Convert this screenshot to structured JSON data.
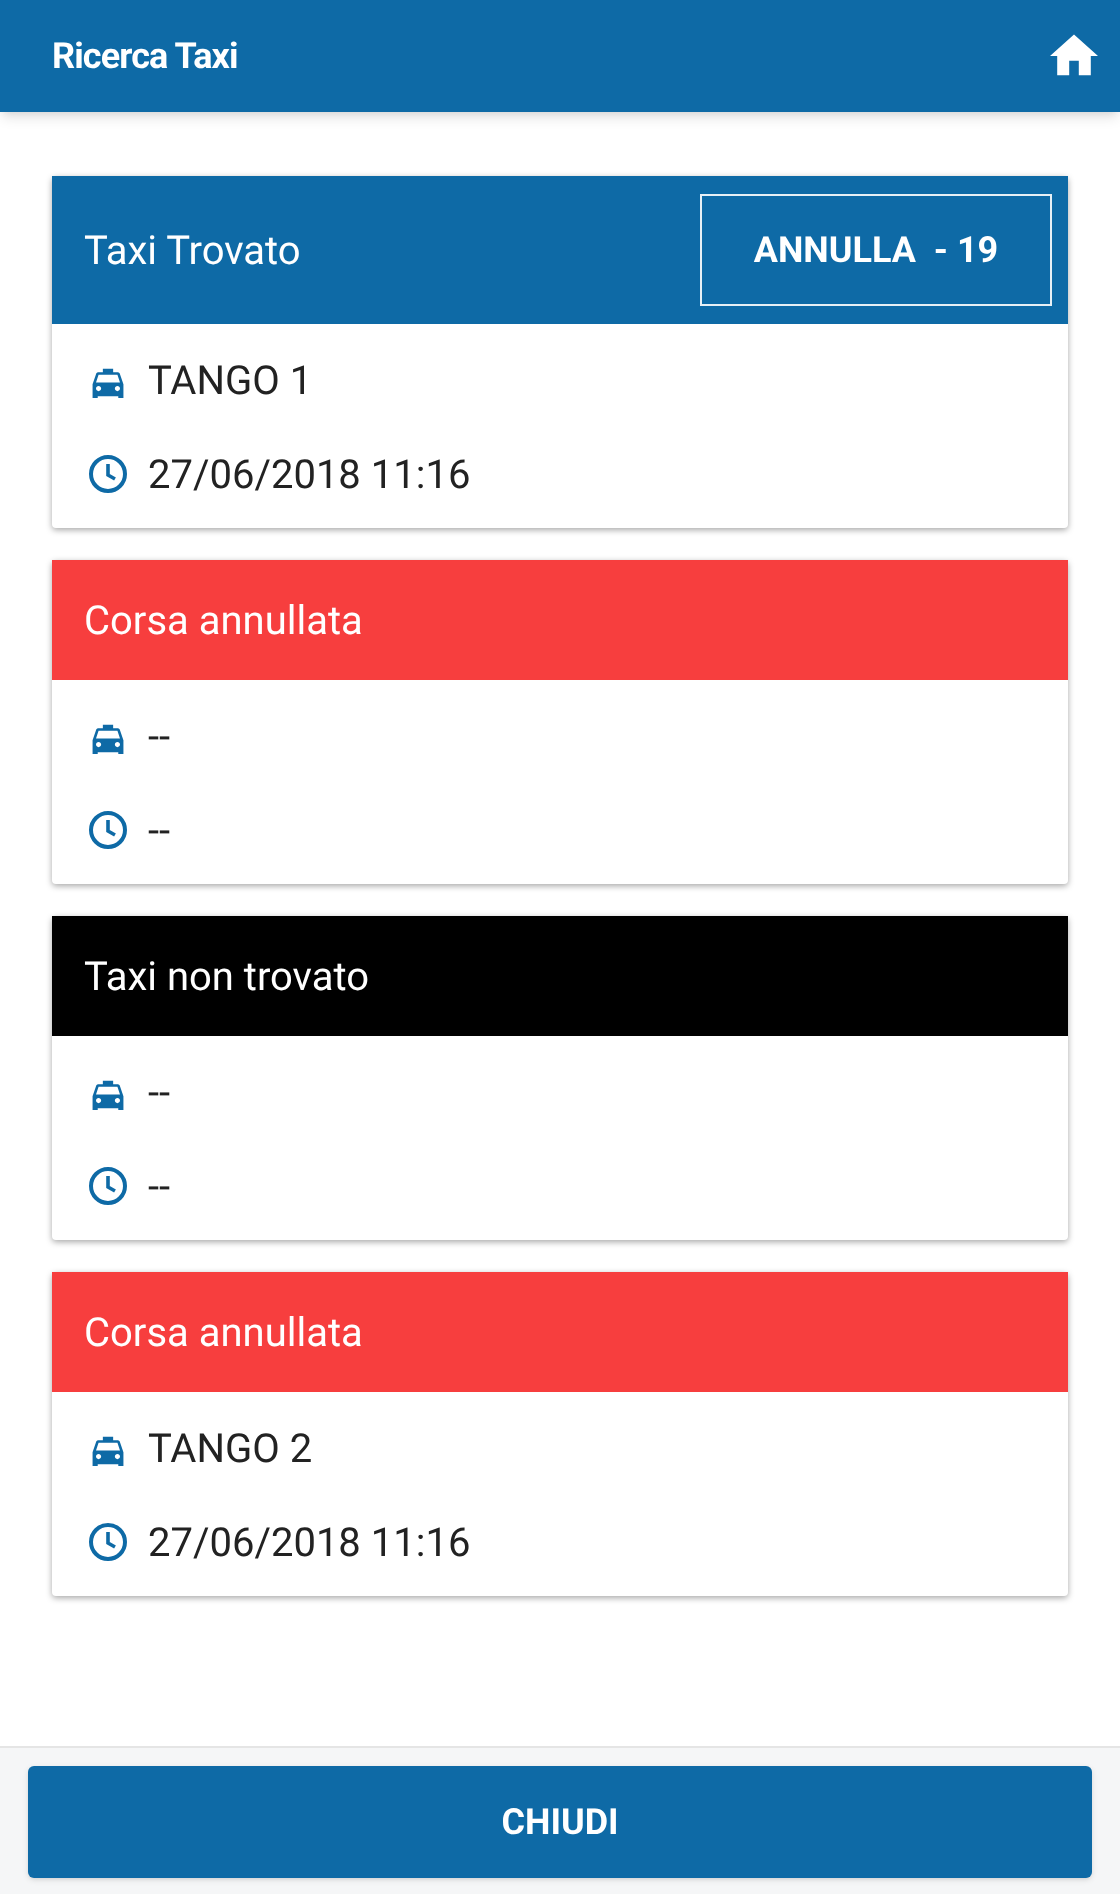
{
  "app_bar": {
    "title": "Ricerca Taxi"
  },
  "rides": [
    {
      "kind": "found",
      "status": "Taxi Trovato",
      "action": "ANNULLA  - 19",
      "taxi": "TANGO 1",
      "time": "27/06/2018 11:16"
    },
    {
      "kind": "cancelled",
      "status": "Corsa annullata",
      "taxi": "--",
      "time": "--"
    },
    {
      "kind": "not_found",
      "status": "Taxi non trovato",
      "taxi": "--",
      "time": "--"
    },
    {
      "kind": "cancelled",
      "status": "Corsa annullata",
      "taxi": "TANGO 2",
      "time": "27/06/2018 11:16"
    }
  ],
  "footer": {
    "button": "CHIUDI"
  }
}
